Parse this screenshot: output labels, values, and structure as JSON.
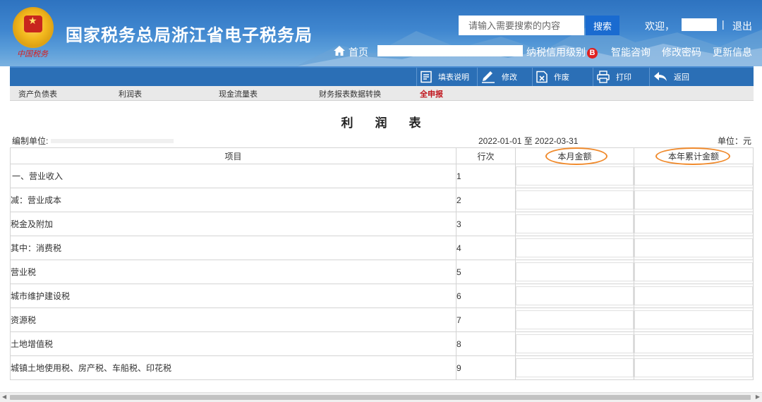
{
  "header": {
    "site_title": "国家税务总局浙江省电子税务局",
    "slogan": "中国税务",
    "search_placeholder": "请输入需要搜索的内容",
    "search_button": "搜索",
    "welcome": "欢迎，",
    "separator": "|",
    "logout": "退出"
  },
  "nav": {
    "home": "首页",
    "credit_level": "纳税信用级别",
    "credit_badge": "B",
    "smart_consult": "智能咨询",
    "change_password": "修改密码",
    "update_info": "更新信息"
  },
  "toolbar": {
    "fill_instructions": "填表说明",
    "edit": "修改",
    "void": "作废",
    "print": "打印",
    "back": "返回"
  },
  "tabs": [
    {
      "label": "资产负债表",
      "active": false
    },
    {
      "label": "利润表",
      "active": false
    },
    {
      "label": "现金流量表",
      "active": false
    },
    {
      "label": "财务报表数据转换",
      "active": false
    },
    {
      "label": "全申报",
      "active": true
    }
  ],
  "report": {
    "title": "利润表",
    "compile_unit_label": "编制单位:",
    "period": "2022-01-01 至 2022-03-31",
    "unit": "单位：元"
  },
  "table": {
    "headers": [
      "项目",
      "行次",
      "本月金额",
      "本年累计金额"
    ],
    "rows": [
      {
        "item": "一、营业收入",
        "no": "1",
        "level": 0
      },
      {
        "item": "减：营业成本",
        "no": "2",
        "level": 1
      },
      {
        "item": "税金及附加",
        "no": "3",
        "level": 1
      },
      {
        "item": "其中：消费税",
        "no": "4",
        "level": 1
      },
      {
        "item": "营业税",
        "no": "5",
        "level": 1
      },
      {
        "item": "城市维护建设税",
        "no": "6",
        "level": 1
      },
      {
        "item": "资源税",
        "no": "7",
        "level": 1
      },
      {
        "item": "土地增值税",
        "no": "8",
        "level": 1
      },
      {
        "item": "城镇土地使用税、房产税、车船税、印花税",
        "no": "9",
        "level": 1
      }
    ]
  },
  "colors": {
    "header_blue": "#2e73c0",
    "toolbar_blue": "#2b6fb6",
    "active_tab": "#c0141c",
    "highlight_circle": "#f08a2c"
  }
}
